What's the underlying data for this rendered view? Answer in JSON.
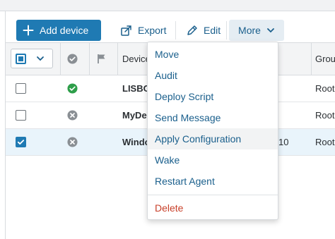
{
  "toolbar": {
    "add_device": "Add device",
    "export": "Export",
    "edit": "Edit",
    "more": "More"
  },
  "table": {
    "columns": [
      "Device",
      "Group"
    ],
    "rows": [
      {
        "name": "LISBO",
        "extra": "",
        "group": "Root",
        "status": "online",
        "checked": false
      },
      {
        "name": "MyDe",
        "extra": "",
        "group": "Root",
        "status": "offline",
        "checked": false
      },
      {
        "name": "Windo",
        "extra": "10",
        "group": "Root",
        "status": "offline",
        "checked": true
      }
    ]
  },
  "menu": {
    "items": [
      "Move",
      "Audit",
      "Deploy Script",
      "Send Message",
      "Apply Configuration",
      "Wake",
      "Restart Agent"
    ],
    "danger_item": "Delete",
    "hovered": "Apply Configuration"
  },
  "colors": {
    "primary": "#1f7ab3",
    "link": "#1a5f8c",
    "online": "#2e9e4a",
    "offline": "#8a8f94",
    "danger": "#c8402a",
    "selected_row": "#e9f4fb"
  }
}
